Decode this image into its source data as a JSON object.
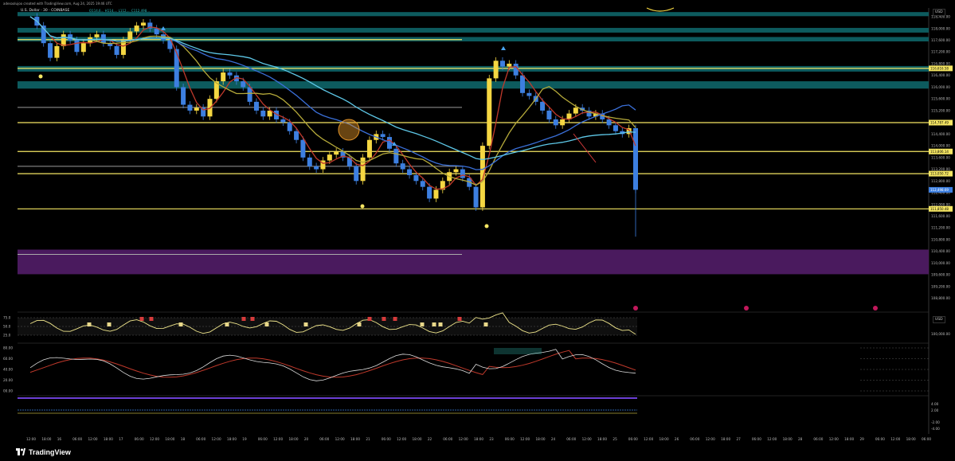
{
  "header": {
    "attribution": "adesoolujoo created with TradingView.com, Aug 24, 2025 19:46 UTC",
    "symbol": "U.S. Dollar · 30 · COINBASE",
    "ohlc": "O114,6... H114,... L112,... C112,498...",
    "currency": "USD",
    "currency2": "USD"
  },
  "footer": {
    "logo_text": "TradingView"
  },
  "colors": {
    "background": "#000000",
    "up_candle": "#f5d742",
    "down_candle": "#3d7fe0",
    "level_line": "#f5e663",
    "zone": "#0d5b5e",
    "purple_zone": "#4a1a5e",
    "ema_fast": "#c0392b",
    "ema_mid": "#b5a93a",
    "ema_slow": "#3a6fd8",
    "ema_slowest": "#5ec8e8"
  },
  "chart_data": {
    "type": "candlestick",
    "title": "",
    "price_axis": {
      "ticks": [
        "118,400.00",
        "118,000.00",
        "117,600.00",
        "117,200.00",
        "116,800.00",
        "116,400.00",
        "116,000.00",
        "115,600.00",
        "115,200.00",
        "114,800.00",
        "114,400.00",
        "114,000.00",
        "113,600.00",
        "113,200.00",
        "112,800.00",
        "112,400.00",
        "112,000.00",
        "111,600.00",
        "111,200.00",
        "110,800.00",
        "110,400.00",
        "110,000.00",
        "109,600.00",
        "109,200.00",
        "108,800.00"
      ],
      "range": [
        108600,
        118700
      ],
      "labels": [
        {
          "text": "116,616.58",
          "price": 116640
        },
        {
          "text": "114,787.49",
          "price": 114790
        },
        {
          "text": "113,806.14",
          "price": 113806
        },
        {
          "text": "113,050.72",
          "price": 113050
        },
        {
          "text": "112,498.69",
          "price": 112498
        },
        {
          "text": "111,850.48",
          "price": 111850
        }
      ]
    },
    "time_axis": [
      "12:00",
      "18:00",
      "16",
      "06:00",
      "12:00",
      "18:00",
      "17",
      "06:00",
      "12:00",
      "18:00",
      "18",
      "06:00",
      "12:00",
      "18:00",
      "19",
      "06:00",
      "12:00",
      "18:00",
      "20",
      "06:00",
      "12:00",
      "18:00",
      "21",
      "06:00",
      "12:00",
      "18:00",
      "22",
      "06:00",
      "12:00",
      "18:00",
      "23",
      "06:00",
      "12:00",
      "18:00",
      "24",
      "06:00",
      "12:00",
      "18:00",
      "25",
      "06:00",
      "12:00",
      "18:00",
      "26",
      "06:00",
      "12:00",
      "18:00",
      "27",
      "06:00",
      "12:00",
      "18:00",
      "28",
      "06:00",
      "12:00",
      "18:00",
      "29",
      "06:00",
      "12:00",
      "18:00",
      "06:00"
    ],
    "level_lines": [
      117620,
      116640,
      114790,
      113806,
      113050,
      111850
    ],
    "gray_lines": [
      115310,
      113300
    ],
    "zones": [
      {
        "from": 118560,
        "to": 118420
      },
      {
        "from": 118020,
        "to": 117860
      },
      {
        "from": 117710,
        "to": 117560
      },
      {
        "from": 116720,
        "to": 116530
      },
      {
        "from": 116200,
        "to": 115950
      }
    ],
    "purple_zone": {
      "from": 110460,
      "to": 109620
    },
    "close_series": [
      118400,
      118100,
      117500,
      117000,
      117400,
      117800,
      117600,
      117200,
      117500,
      117700,
      117800,
      117500,
      117400,
      117100,
      117600,
      117900,
      118100,
      118200,
      118000,
      117800,
      117600,
      117300,
      116000,
      115400,
      115200,
      115300,
      115000,
      115600,
      116200,
      116500,
      116400,
      116200,
      116000,
      115500,
      115200,
      115000,
      115200,
      114900,
      114800,
      114500,
      114200,
      113600,
      113300,
      113200,
      113500,
      113700,
      113800,
      113600,
      113300,
      112800,
      113600,
      114200,
      114400,
      114300,
      113900,
      113400,
      113200,
      113000,
      112800,
      112600,
      112200,
      112500,
      112800,
      113100,
      113200,
      112900,
      112600,
      111900,
      114000,
      116300,
      116900,
      116700,
      116800,
      116400,
      115800,
      115700,
      115500,
      115200,
      114900,
      114700,
      114900,
      115100,
      115300,
      115200,
      115000,
      115100,
      114900,
      114700,
      114500,
      114400,
      114600,
      112500
    ]
  },
  "indicators": {
    "rsi": {
      "ticks": [
        "75.0",
        "50.0",
        "25.0"
      ],
      "right_tick": "100,000.00"
    },
    "stoch": {
      "ticks": [
        "80.00",
        "60.00",
        "40.00",
        "20.00",
        "00.00"
      ]
    },
    "osc": {
      "ticks": [
        "4.00",
        "2.00",
        "-2.00",
        "-4.00"
      ]
    }
  }
}
